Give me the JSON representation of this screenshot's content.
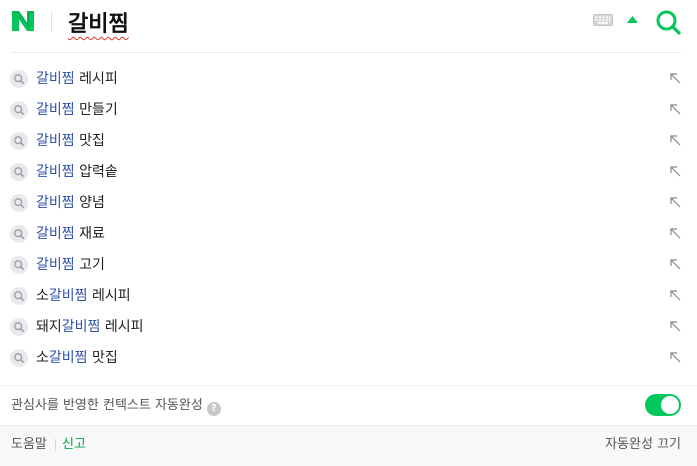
{
  "header": {
    "query": "갈비찜"
  },
  "suggestions": [
    {
      "prefix": "",
      "match": "갈비찜",
      "suffix": " 레시피"
    },
    {
      "prefix": "",
      "match": "갈비찜",
      "suffix": " 만들기"
    },
    {
      "prefix": "",
      "match": "갈비찜",
      "suffix": " 맛집"
    },
    {
      "prefix": "",
      "match": "갈비찜",
      "suffix": " 압력솥"
    },
    {
      "prefix": "",
      "match": "갈비찜",
      "suffix": " 양념"
    },
    {
      "prefix": "",
      "match": "갈비찜",
      "suffix": " 재료"
    },
    {
      "prefix": "",
      "match": "갈비찜",
      "suffix": " 고기"
    },
    {
      "prefix": "소",
      "match": "갈비찜",
      "suffix": " 레시피"
    },
    {
      "prefix": "돼지",
      "match": "갈비찜",
      "suffix": " 레시피"
    },
    {
      "prefix": "소",
      "match": "갈비찜",
      "suffix": " 맛집"
    }
  ],
  "context": {
    "label": "관심사를 반영한 컨텍스트 자동완성",
    "help_glyph": "?",
    "toggle_on": true
  },
  "footer": {
    "help": "도움말",
    "report": "신고",
    "autocomplete_off": "자동완성 끄기"
  },
  "colors": {
    "brand_green": "#03c75a",
    "highlight_blue": "#2f52a8",
    "spellcheck_red": "#e0332b"
  }
}
